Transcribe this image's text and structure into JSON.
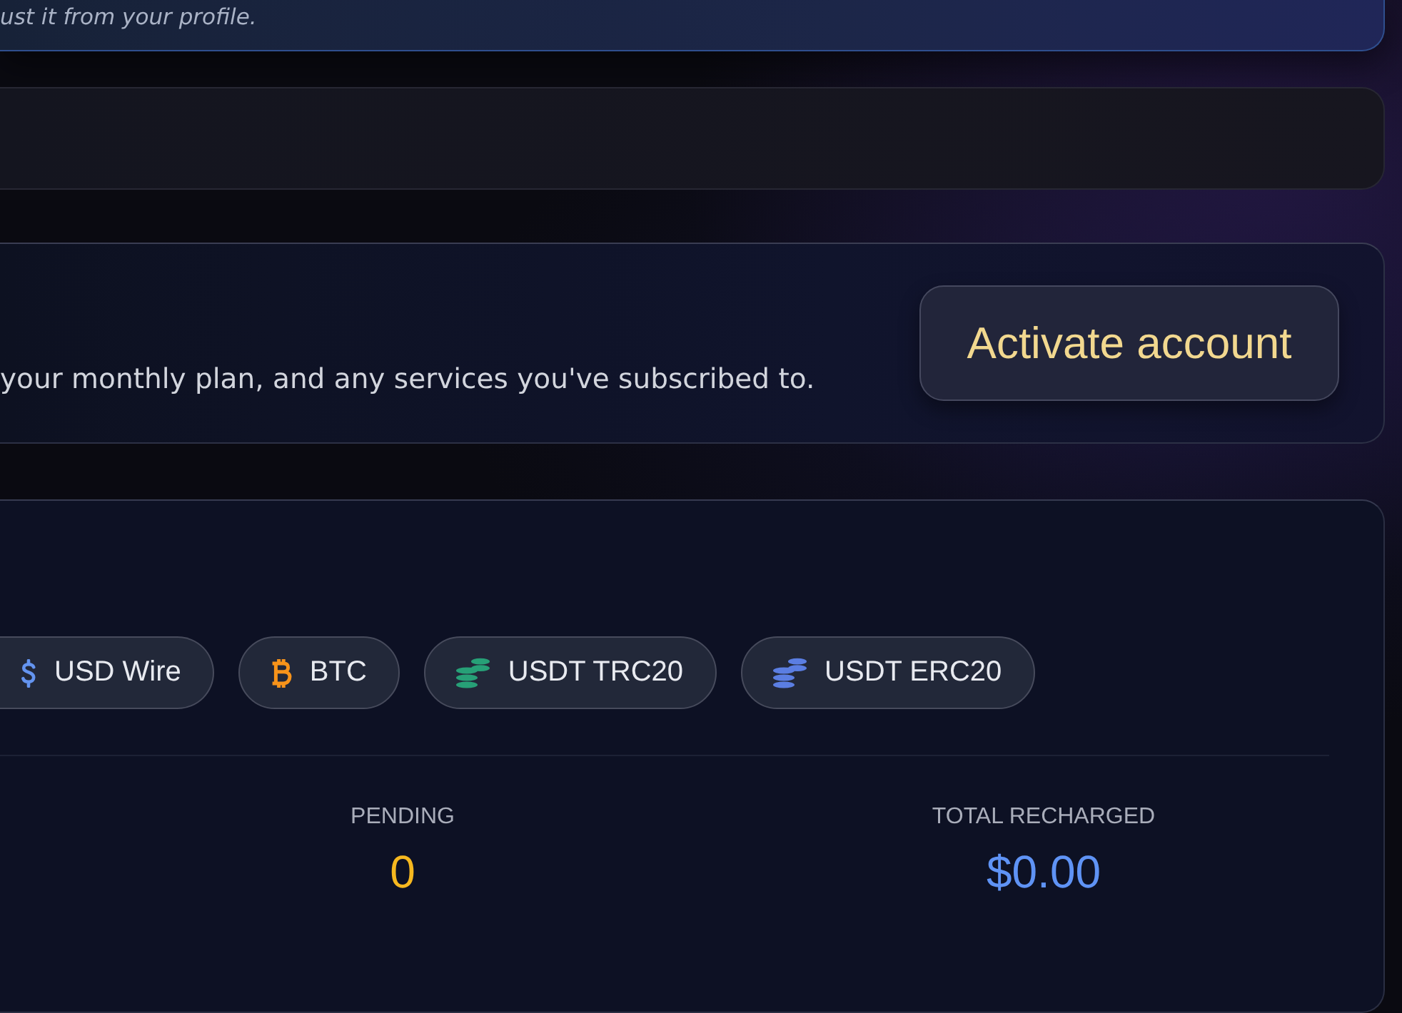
{
  "profile_notice": {
    "text": "ust it from your profile."
  },
  "activation": {
    "description": "your monthly plan, and any services you've subscribed to.",
    "button": "Activate account"
  },
  "recharge": {
    "payment_methods": [
      {
        "label": "USD Wire",
        "kind": "dollar",
        "color": "#6494f0"
      },
      {
        "label": "BTC",
        "kind": "bitcoin",
        "color": "#f7931a"
      },
      {
        "label": "USDT TRC20",
        "kind": "coins",
        "color": "#27a077"
      },
      {
        "label": "USDT ERC20",
        "kind": "coins",
        "color": "#5b7ee2"
      }
    ],
    "stats": [
      {
        "label": "PENDING",
        "value": "0",
        "color": "#f6b81f"
      },
      {
        "label": "TOTAL RECHARGED",
        "value": "$0.00",
        "color": "#5f93f5"
      }
    ]
  }
}
